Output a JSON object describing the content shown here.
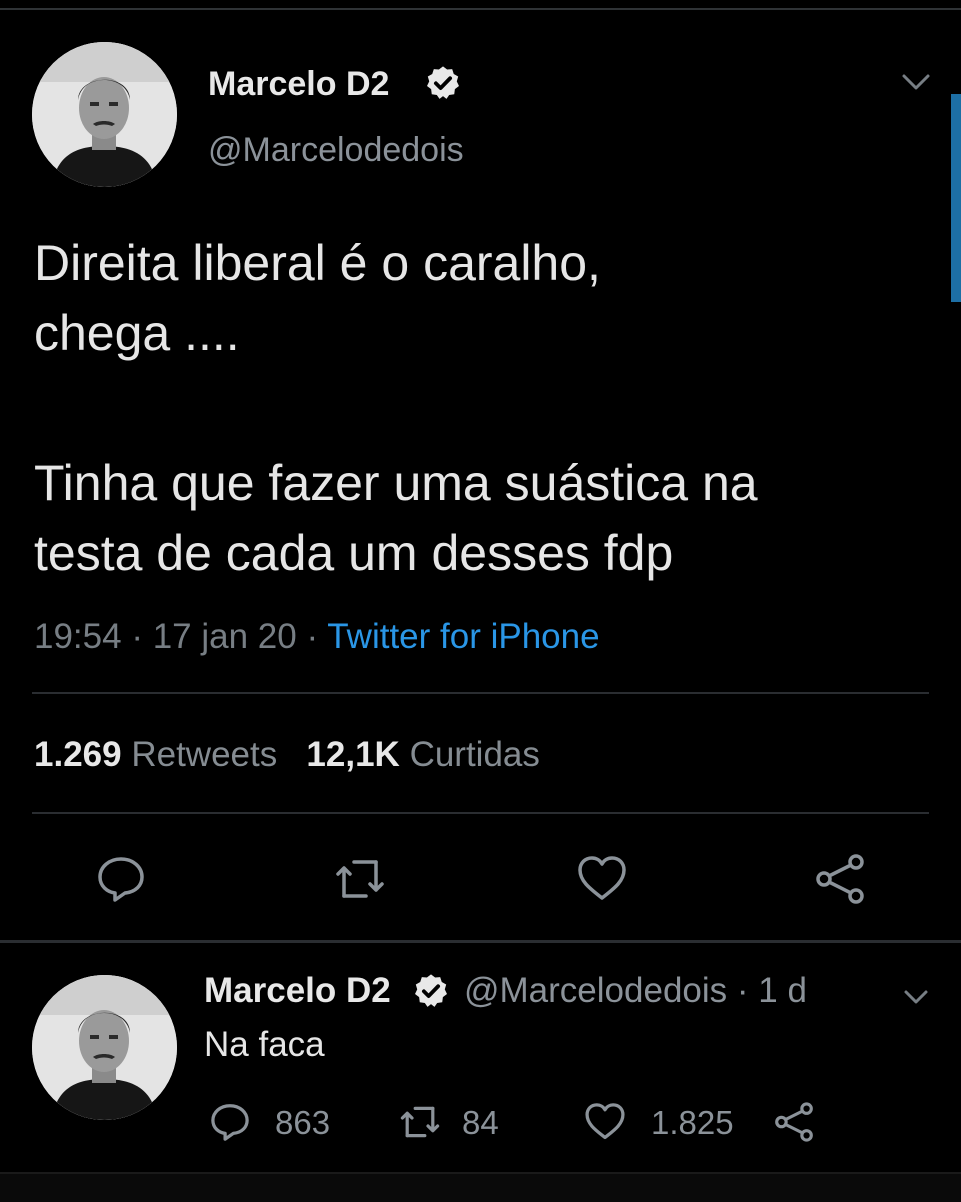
{
  "tweet": {
    "author_name": "Marcelo D2",
    "author_handle": "@Marcelodedois",
    "text_lines": [
      "Direita liberal é o caralho,",
      "chega ....",
      "Tinha que fazer uma suástica na",
      "testa de cada um desses fdp"
    ],
    "time": "19:54",
    "date": "17 jan 20",
    "separator": "·",
    "source": "Twitter for iPhone",
    "retweets_count": "1.269",
    "retweets_label": "Retweets",
    "likes_count": "12,1K",
    "likes_label": "Curtidas",
    "actions": [
      "reply-icon",
      "retweet-icon",
      "like-icon",
      "share-icon"
    ]
  },
  "reply": {
    "author_name": "Marcelo D2",
    "author_handle": "@Marcelodedois",
    "age": "· 1 d",
    "text": "Na faca",
    "reply_count": "863",
    "retweet_count": "84",
    "like_count": "1.825"
  },
  "colors": {
    "background": "#000000",
    "accent": "#2a96e6",
    "muted": "#8b9299",
    "icon": "#8b9299",
    "scrollbar": "#1d6fa5"
  }
}
